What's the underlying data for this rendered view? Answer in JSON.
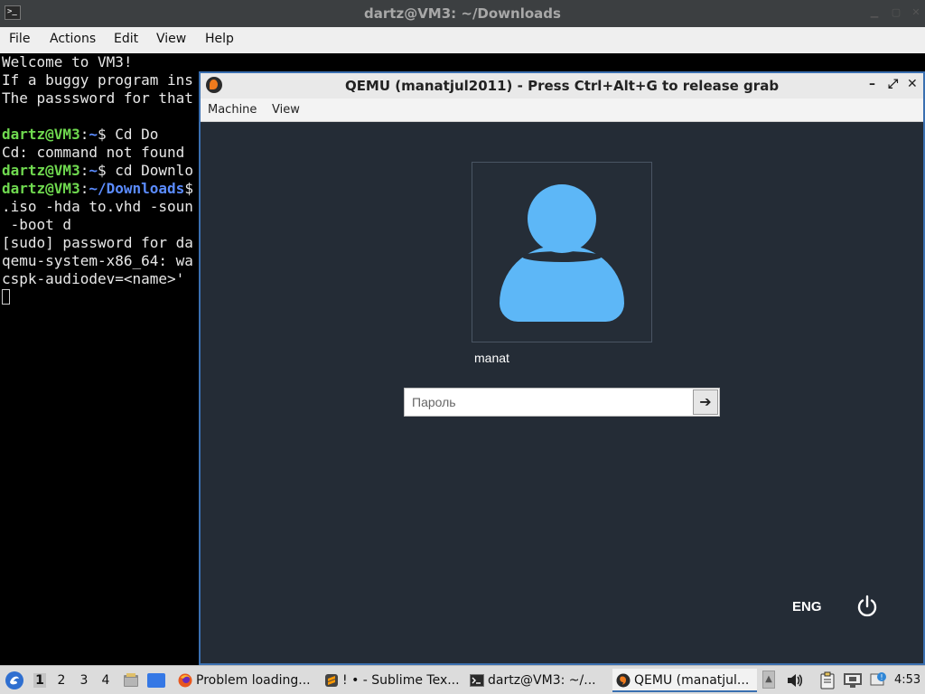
{
  "terminal": {
    "title": "dartz@VM3: ~/Downloads",
    "menu": [
      "File",
      "Actions",
      "Edit",
      "View",
      "Help"
    ],
    "lines": [
      {
        "text": "Welcome to VM3!"
      },
      {
        "text": "If a buggy program ins"
      },
      {
        "text": "The passsword for that"
      },
      {
        "text": ""
      },
      {
        "user": "dartz@VM3",
        "path": "~",
        "prompt": "$ ",
        "text": "Cd Do"
      },
      {
        "text": "Cd: command not found"
      },
      {
        "user": "dartz@VM3",
        "path": "~",
        "prompt": "$ ",
        "text": "cd Downlo"
      },
      {
        "user": "dartz@VM3",
        "path": "~/Downloads",
        "prompt": "$",
        "text": ""
      },
      {
        "text": ".iso -hda to.vhd -soun"
      },
      {
        "text": " -boot d"
      },
      {
        "text": "[sudo] password for da"
      },
      {
        "text": "qemu-system-x86_64: wa"
      },
      {
        "text": "cspk-audiodev=<name>'"
      }
    ]
  },
  "qemu": {
    "title": "QEMU (manatjul2011) - Press Ctrl+Alt+G to release grab",
    "menu": [
      "Machine",
      "View"
    ],
    "login": {
      "username": "manat",
      "password_placeholder": "Пароль",
      "submit_glyph": "➔",
      "language": "ENG"
    }
  },
  "taskbar": {
    "workspaces": [
      "1",
      "2",
      "3",
      "4"
    ],
    "active_workspace": "1",
    "tasks": [
      {
        "label": "Problem loading...",
        "icon": "firefox-icon"
      },
      {
        "label": "! • - Sublime Tex...",
        "icon": "sublime-icon"
      },
      {
        "label": "dartz@VM3: ~/...",
        "icon": "terminal-icon"
      },
      {
        "label": "QEMU (manatjul...",
        "icon": "qemu-icon",
        "active": true
      }
    ],
    "clock": "4:53"
  },
  "colors": {
    "accent": "#3a6fb0",
    "avatar": "#5db7f7",
    "login_bg": "#242c36",
    "prompt_user": "#6fd94f",
    "prompt_path": "#5b8cff"
  }
}
